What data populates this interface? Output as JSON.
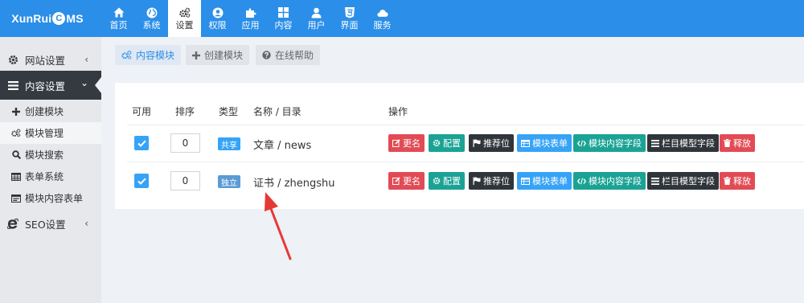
{
  "logo": {
    "part1": "XunRui",
    "c": "C",
    "part2": "MS"
  },
  "topnav": [
    {
      "label": "首页",
      "icon": "home-icon"
    },
    {
      "label": "系统",
      "icon": "globe-icon"
    },
    {
      "label": "设置",
      "icon": "cogs-icon",
      "active": true
    },
    {
      "label": "权限",
      "icon": "user-circle-icon"
    },
    {
      "label": "应用",
      "icon": "puzzle-icon"
    },
    {
      "label": "内容",
      "icon": "grid-icon"
    },
    {
      "label": "用户",
      "icon": "user-icon"
    },
    {
      "label": "界面",
      "icon": "html5-icon"
    },
    {
      "label": "服务",
      "icon": "cloud-icon"
    }
  ],
  "sidebar": {
    "groups": {
      "site": {
        "label": "网站设置",
        "caret": "‹"
      },
      "content": {
        "label": "内容设置",
        "caret": "⌄"
      },
      "seo": {
        "label": "SEO设置",
        "caret": "‹"
      }
    },
    "items": [
      {
        "label": "创建模块",
        "icon": "plus-icon"
      },
      {
        "label": "模块管理",
        "icon": "cogs-icon"
      },
      {
        "label": "模块搜索",
        "icon": "search-icon"
      },
      {
        "label": "表单系统",
        "icon": "table-icon"
      },
      {
        "label": "模块内容表单",
        "icon": "window-icon"
      }
    ]
  },
  "toolbar": {
    "content_module": "内容模块",
    "create_module": "创建模块",
    "online_help": "在线帮助"
  },
  "table": {
    "headers": {
      "enabled": "可用",
      "order": "排序",
      "type": "类型",
      "name": "名称 / 目录",
      "actions": "操作"
    },
    "rows": [
      {
        "enabled": true,
        "order": "0",
        "type": "共享",
        "name": "文章 / news"
      },
      {
        "enabled": true,
        "order": "0",
        "type": "独立",
        "name": "证书 / zhengshu"
      }
    ],
    "actions": {
      "rename": "更名",
      "config": "配置",
      "recommend": "推荐位",
      "module_form": "模块表单",
      "content_fields": "模块内容字段",
      "category_fields": "栏目模型字段",
      "release": "释放"
    }
  },
  "colors": {
    "topbar": "#2b8ee8",
    "accent_blue": "#36a3f7",
    "red": "#e24b55",
    "teal": "#1aa394",
    "dark": "#2f353b",
    "arrow": "#e53935"
  }
}
